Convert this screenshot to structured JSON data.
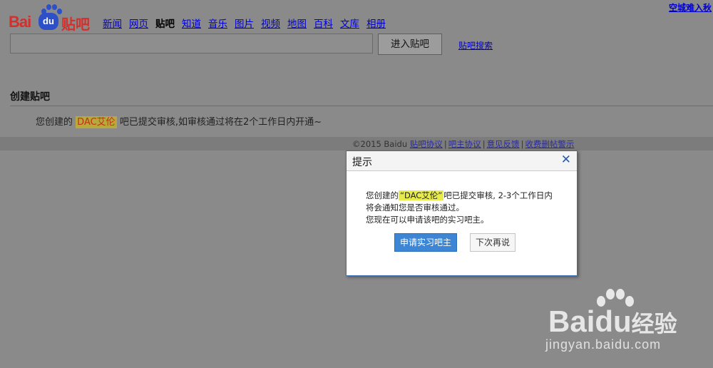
{
  "topbar": {
    "right_link": "空城难入秋"
  },
  "logo": {
    "part1": "Bai",
    "part2": "du",
    "part3": "贴吧"
  },
  "nav": {
    "items": [
      {
        "label": "新闻",
        "active": false
      },
      {
        "label": "网页",
        "active": false
      },
      {
        "label": "贴吧",
        "active": true
      },
      {
        "label": "知道",
        "active": false
      },
      {
        "label": "音乐",
        "active": false
      },
      {
        "label": "图片",
        "active": false
      },
      {
        "label": "视频",
        "active": false
      },
      {
        "label": "地图",
        "active": false
      },
      {
        "label": "百科",
        "active": false
      },
      {
        "label": "文库",
        "active": false
      },
      {
        "label": "相册",
        "active": false
      }
    ]
  },
  "search": {
    "value": "",
    "button_label": "进入贴吧",
    "link_label": "贴吧搜索"
  },
  "page": {
    "title": "创建贴吧",
    "notice_prefix": "您创建的",
    "notice_name": "DAC艾伦",
    "notice_suffix": "吧已提交审核,如审核通过将在2个工作日内开通~"
  },
  "footer": {
    "copyright": "©2015 Baidu",
    "links": [
      "贴吧协议",
      "吧主协议",
      "意见反馈",
      "收费删帖警示"
    ]
  },
  "dialog": {
    "title": "提示",
    "close_icon": "close-icon",
    "line1_prefix": "您创建的",
    "line1_name": "“DAC艾伦”",
    "line1_suffix": "吧已提交审核, 2-3个工作日内",
    "line2": "将会通知您是否审核通过。",
    "line3": "您现在可以申请该吧的实习吧主。",
    "primary_button": "申请实习吧主",
    "secondary_button": "下次再说",
    "accent_color": "#3d86d6"
  },
  "watermark": {
    "brand_text": "Bai",
    "brand_du": "du",
    "brand_cn": "经验",
    "url": "jingyan.baidu.com"
  }
}
